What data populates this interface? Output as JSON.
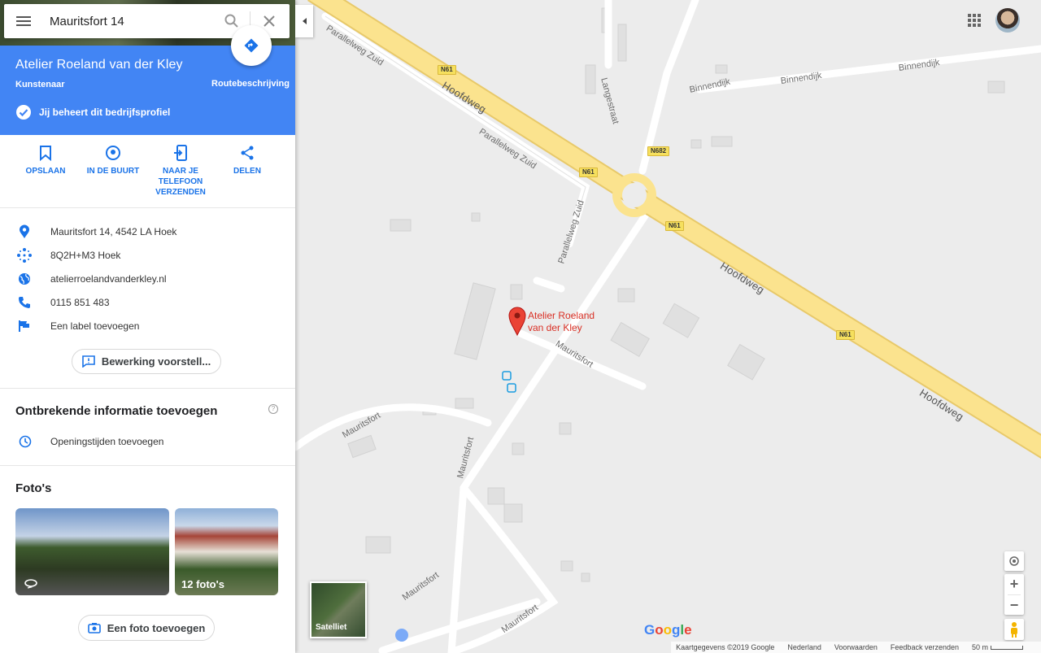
{
  "search": {
    "query": "Mauritsfort 14"
  },
  "place": {
    "name": "Atelier Roeland van der Kley",
    "category": "Kunstenaar",
    "verified_text": "Jij beheert dit bedrijfsprofiel",
    "route_label": "Routebeschrijving"
  },
  "actions": [
    {
      "label": "OPSLAAN",
      "icon": "bookmark-icon"
    },
    {
      "label": "IN DE BUURT",
      "icon": "nearby-icon"
    },
    {
      "label": "NAAR JE TELEFOON VERZENDEN",
      "icon": "send-to-phone-icon"
    },
    {
      "label": "DELEN",
      "icon": "share-icon"
    }
  ],
  "info": {
    "address": "Mauritsfort 14, 4542 LA Hoek",
    "plus_code": "8Q2H+M3 Hoek",
    "website": "atelierroelandvanderkley.nl",
    "phone": "0115 851 483",
    "label": "Een label toevoegen",
    "suggest_edit": "Bewerking voorstell..."
  },
  "missing": {
    "title": "Ontbrekende informatie toevoegen",
    "hours": "Openingstijden toevoegen"
  },
  "photos": {
    "title": "Foto's",
    "count_label": "12 foto's",
    "add_label": "Een foto toevoegen"
  },
  "map": {
    "pin_label_line1": "Atelier Roeland",
    "pin_label_line2": "van der Kley",
    "satellite_label": "Satelliet",
    "google": "Google",
    "roads": {
      "hoofdweg": "Hoofdweg",
      "parallelweg": "Parallelweg Zuid",
      "binnendijk": "Binnendijk",
      "langestraat": "Langestraat",
      "mauritsfort": "Mauritsfort",
      "n61": "N61",
      "n682": "N682"
    },
    "footer": {
      "copyright": "Kaartgegevens ©2019 Google",
      "country": "Nederland",
      "terms": "Voorwaarden",
      "feedback": "Feedback verzenden",
      "scale": "50 m"
    }
  },
  "colors": {
    "accent": "#4285f4",
    "link": "#1a73e8",
    "pin": "#d93025",
    "highway": "#fbe38e"
  }
}
